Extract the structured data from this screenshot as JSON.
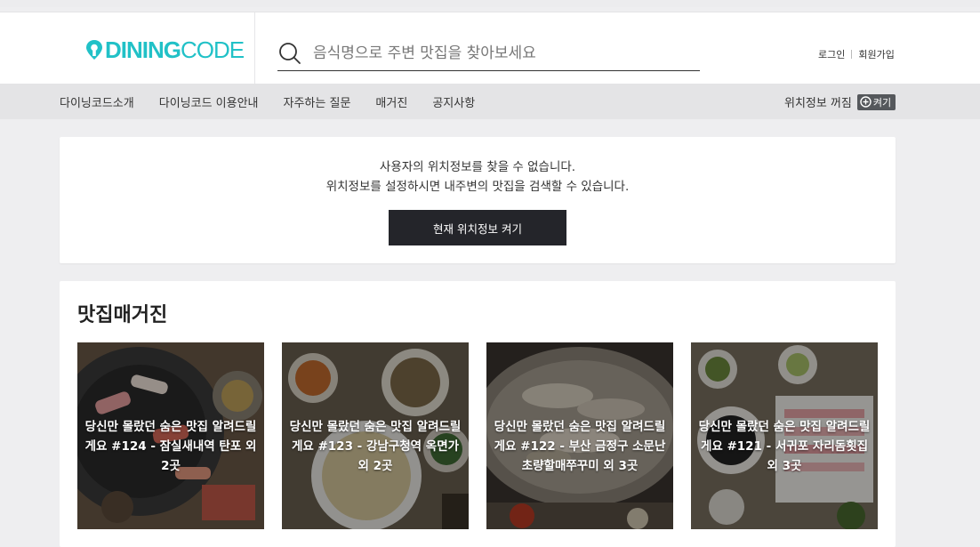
{
  "header": {
    "logo_text_bold": "DINING",
    "logo_text_light": "CODE",
    "search_placeholder": "음식명으로 주변 맛집을 찾아보세요",
    "login_label": "로그인",
    "signup_label": "회원가입",
    "brand_color": "#21c1c7"
  },
  "nav": {
    "items": [
      {
        "label": "다이닝코드소개"
      },
      {
        "label": "다이닝코드 이용안내"
      },
      {
        "label": "자주하는 질문"
      },
      {
        "label": "매거진"
      },
      {
        "label": "공지사항"
      }
    ],
    "location_status": "위치정보 꺼짐",
    "location_toggle": "켜기"
  },
  "location_notice": {
    "message_line1": "사용자의 위치정보를 찾을 수 없습니다.",
    "message_line2": "위치정보를 설정하시면 내주변의 맛집을 검색할 수 있습니다.",
    "button_label": "현재 위치정보 켜기"
  },
  "magazine": {
    "heading": "맛집매거진",
    "items": [
      {
        "title": "당신만 몰랐던 숨은 맛집 알려드릴게요 #124 - 잠실새내역 탄포 외 2곳",
        "image": "sashimi-platter"
      },
      {
        "title": "당신만 몰랐던 숨은 맛집 알려드릴게요 #123 - 강남구청역 옥면가 외 2곳",
        "image": "noodle-table"
      },
      {
        "title": "당신만 몰랐던 숨은 맛집 알려드릴게요 #122 - 부산 금정구 소문난 초량할매쭈꾸미 외 3곳",
        "image": "hotpot"
      },
      {
        "title": "당신만 몰랐던 숨은 맛집 알려드릴게요 #121 - 서귀포 자리돔횟집 외 3곳",
        "image": "raw-fish-table"
      }
    ]
  }
}
